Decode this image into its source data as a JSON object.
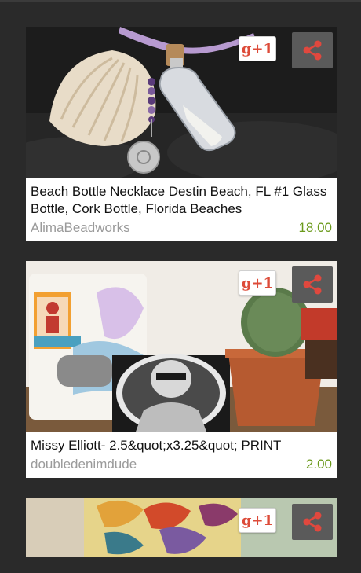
{
  "feed": {
    "items": [
      {
        "title": "Beach Bottle Necklace Destin Beach, FL #1 Glass Bottle, Cork Bottle, Florida Beaches",
        "seller": "AlimaBeadworks",
        "price": "18.00",
        "plus_label": "g+1",
        "share_icon": "share-icon"
      },
      {
        "title": "Missy Elliott- 2.5&quot;x3.25&quot; PRINT",
        "seller": "doubledenimdude",
        "price": "2.00",
        "plus_label": "g+1",
        "share_icon": "share-icon"
      },
      {
        "plus_label": "g+1",
        "share_icon": "share-icon"
      }
    ]
  },
  "colors": {
    "background": "#2a2a2a",
    "card": "#ffffff",
    "seller_text": "#9b9b9b",
    "price_text": "#6b9a1c",
    "gplus_red": "#dd4b39",
    "share_red": "#e0483e"
  }
}
